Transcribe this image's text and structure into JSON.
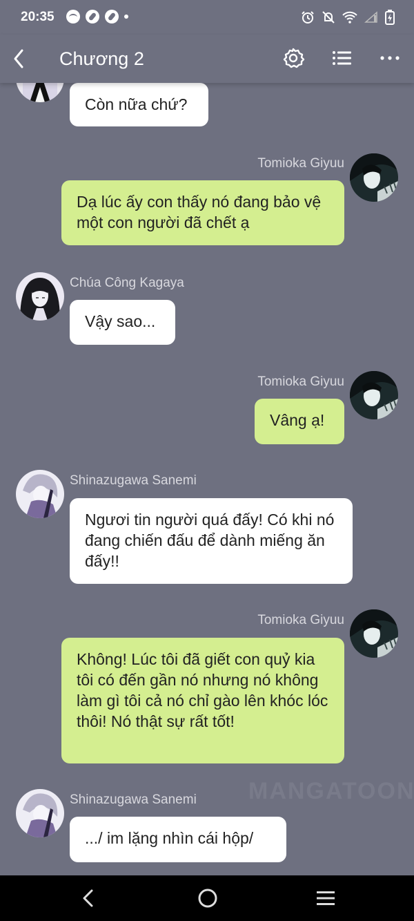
{
  "status_bar": {
    "time": "20:35",
    "left_icons": [
      "spotify-icon",
      "compass-icon",
      "compass-icon",
      "dot-icon"
    ],
    "right_icons": [
      "alarm-icon",
      "mute-icon",
      "wifi-icon",
      "signal-icon",
      "battery-icon"
    ]
  },
  "top_bar": {
    "title": "Chương 2",
    "icons": [
      "back-arrow-icon",
      "gear-icon",
      "list-icon",
      "more-icon"
    ]
  },
  "messages": [
    {
      "side": "left",
      "speaker": "",
      "text": "Còn nữa chứ?",
      "avatar": "kagaya"
    },
    {
      "side": "right",
      "speaker": "Tomioka Giyuu",
      "text": "Dạ lúc ấy con thấy nó đang bảo vệ một con người đã chết ạ",
      "avatar": "giyuu"
    },
    {
      "side": "left",
      "speaker": "Chúa Công Kagaya",
      "text": "Vậy sao...",
      "avatar": "kagaya"
    },
    {
      "side": "right",
      "speaker": "Tomioka Giyuu",
      "text": "Vâng ạ!",
      "avatar": "giyuu"
    },
    {
      "side": "left",
      "speaker": "Shinazugawa Sanemi",
      "text": "Ngươi tin người quá đấy! Có khi nó đang chiến đấu để dành miếng ăn đấy!!",
      "avatar": "sanemi"
    },
    {
      "side": "right",
      "speaker": "Tomioka Giyuu",
      "text": "Không! Lúc tôi đã giết con quỷ kia tôi có đến gần nó nhưng nó không làm gì tôi cả nó chỉ gào lên khóc lóc thôi! Nó thật sự rất tốt!",
      "avatar": "giyuu"
    },
    {
      "side": "left",
      "speaker": "Shinazugawa Sanemi",
      "text": ".../ im lặng nhìn cái hộp/",
      "avatar": "sanemi"
    }
  ],
  "watermark": "MANGATOON",
  "nav_bar": {
    "icons": [
      "back-icon",
      "home-icon",
      "recents-icon"
    ]
  },
  "colors": {
    "background": "#6e7080",
    "bubble_left": "#ffffff",
    "bubble_right": "#d4ee90",
    "name_text": "#d8d8de"
  }
}
